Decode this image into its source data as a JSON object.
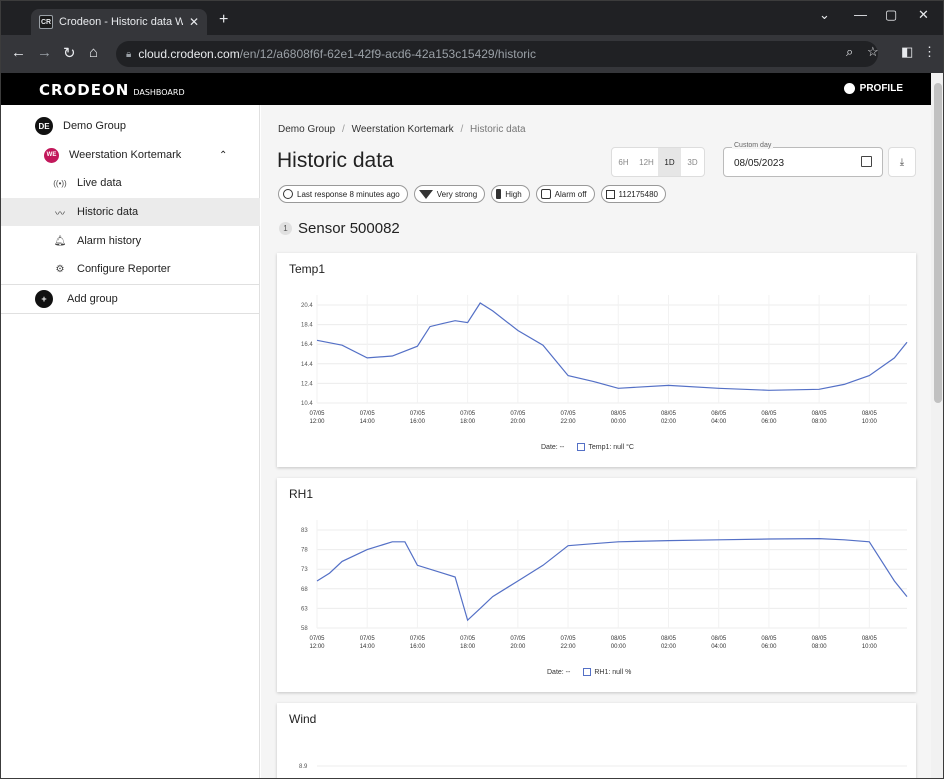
{
  "browser": {
    "tab_title": "Crodeon - Historic data Weerstati",
    "tab_favicon": "CR",
    "url_host": "cloud.crodeon.com",
    "url_path": "/en/12/a6808f6f-62e1-42f9-acd6-42a153c15429/historic"
  },
  "app": {
    "brand": "CRODEON",
    "brand_sub": "DASHBOARD",
    "profile_label": "PROFILE"
  },
  "sidebar": {
    "group": {
      "avatar": "DE",
      "label": "Demo Group"
    },
    "station": {
      "avatar": "WE",
      "label": "Weerstation Kortemark"
    },
    "items": [
      {
        "label": "Live data",
        "icon": "radio-waves-icon"
      },
      {
        "label": "Historic data",
        "icon": "chart-line-icon"
      },
      {
        "label": "Alarm history",
        "icon": "bell-icon"
      },
      {
        "label": "Configure Reporter",
        "icon": "gear-icon"
      }
    ],
    "add_group": "Add group"
  },
  "main": {
    "breadcrumb": [
      "Demo Group",
      "Weerstation Kortemark",
      "Historic data"
    ],
    "breadcrumb_sep": "/",
    "title": "Historic data",
    "ranges": [
      "6H",
      "12H",
      "1D",
      "3D"
    ],
    "selected_range": "1D",
    "custom_day_label": "Custom day",
    "custom_day_value": "08/05/2023",
    "chips": [
      "Last response 8 minutes ago",
      "Very strong",
      "High",
      "Alarm off",
      "112175480"
    ],
    "sensor_index": "1",
    "sensor_title": "Sensor 500082"
  },
  "colors": {
    "accent": "#5470c6",
    "station_avatar": "#c2185b"
  },
  "chart_data": [
    {
      "type": "line",
      "title": "Temp1",
      "x": [
        "07/05 12:00",
        "07/05 13:00",
        "07/05 14:00",
        "07/05 15:00",
        "07/05 16:00",
        "07/05 16:30",
        "07/05 17:00",
        "07/05 17:30",
        "07/05 18:00",
        "07/05 18:30",
        "07/05 19:00",
        "07/05 20:00",
        "07/05 21:00",
        "07/05 22:00",
        "07/05 23:00",
        "08/05 00:00",
        "08/05 02:00",
        "08/05 04:00",
        "08/05 06:00",
        "08/05 08:00",
        "08/05 09:00",
        "08/05 10:00",
        "08/05 11:00",
        "08/05 11:30"
      ],
      "series": [
        {
          "name": "Temp1",
          "values": [
            16.8,
            16.3,
            15.0,
            15.2,
            16.2,
            18.2,
            18.5,
            18.8,
            18.6,
            20.6,
            19.8,
            17.8,
            16.3,
            13.2,
            12.6,
            11.9,
            12.2,
            11.9,
            11.7,
            11.8,
            12.3,
            13.2,
            15.0,
            16.6
          ]
        }
      ],
      "ylim": [
        10.4,
        20.4
      ],
      "yticks": [
        "20.4",
        "18.4",
        "16.4",
        "14.4",
        "12.4",
        "10.4"
      ],
      "xticks": [
        [
          "07/05",
          "12:00"
        ],
        [
          "07/05",
          "14:00"
        ],
        [
          "07/05",
          "16:00"
        ],
        [
          "07/05",
          "18:00"
        ],
        [
          "07/05",
          "20:00"
        ],
        [
          "07/05",
          "22:00"
        ],
        [
          "08/05",
          "00:00"
        ],
        [
          "08/05",
          "02:00"
        ],
        [
          "08/05",
          "04:00"
        ],
        [
          "08/05",
          "06:00"
        ],
        [
          "08/05",
          "08:00"
        ],
        [
          "08/05",
          "10:00"
        ]
      ],
      "legend_date": "Date: --",
      "legend_series": "Temp1: null °C"
    },
    {
      "type": "line",
      "title": "RH1",
      "x": [
        "07/05 12:00",
        "07/05 12:30",
        "07/05 13:00",
        "07/05 14:00",
        "07/05 15:00",
        "07/05 15:30",
        "07/05 16:00",
        "07/05 17:00",
        "07/05 17:30",
        "07/05 18:00",
        "07/05 18:30",
        "07/05 19:00",
        "07/05 20:00",
        "07/05 21:00",
        "07/05 22:00",
        "07/05 23:00",
        "08/05 00:00",
        "08/05 02:00",
        "08/05 04:00",
        "08/05 06:00",
        "08/05 08:00",
        "08/05 09:00",
        "08/05 10:00",
        "08/05 11:00",
        "08/05 11:30"
      ],
      "series": [
        {
          "name": "RH1",
          "values": [
            70,
            72,
            75,
            78,
            80,
            80,
            74,
            72,
            71,
            60,
            63,
            66,
            70,
            74,
            79,
            79.5,
            80,
            80.3,
            80.5,
            80.7,
            80.8,
            80.5,
            80,
            70,
            66
          ]
        }
      ],
      "ylim": [
        58,
        83
      ],
      "yticks": [
        "83",
        "78",
        "73",
        "68",
        "63",
        "58"
      ],
      "xticks": [
        [
          "07/05",
          "12:00"
        ],
        [
          "07/05",
          "14:00"
        ],
        [
          "07/05",
          "16:00"
        ],
        [
          "07/05",
          "18:00"
        ],
        [
          "07/05",
          "20:00"
        ],
        [
          "07/05",
          "22:00"
        ],
        [
          "08/05",
          "00:00"
        ],
        [
          "08/05",
          "02:00"
        ],
        [
          "08/05",
          "04:00"
        ],
        [
          "08/05",
          "06:00"
        ],
        [
          "08/05",
          "08:00"
        ],
        [
          "08/05",
          "10:00"
        ]
      ],
      "legend_date": "Date: --",
      "legend_series": "RH1: null %"
    },
    {
      "type": "line",
      "title": "Wind",
      "yticks": [
        "8.9"
      ]
    }
  ]
}
